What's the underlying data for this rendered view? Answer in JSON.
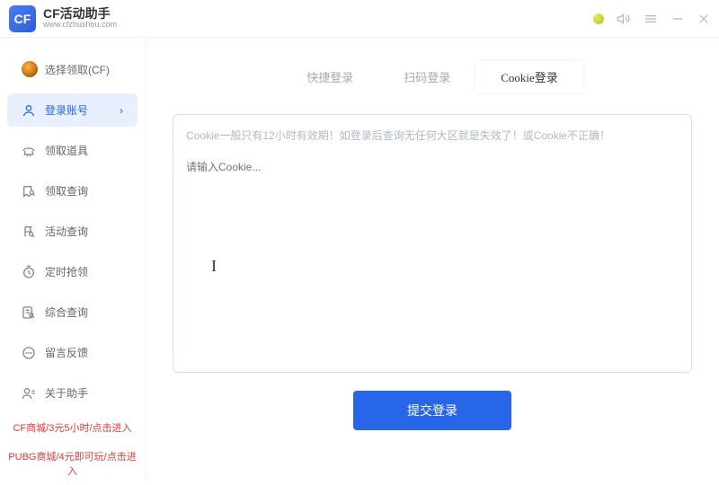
{
  "header": {
    "logo_text": "CF",
    "title": "CF活动助手",
    "url": "www.cfzhushou.com"
  },
  "sidebar": {
    "items": [
      {
        "label": "选择领取(CF)",
        "icon": "crown"
      },
      {
        "label": "登录账号",
        "icon": "user",
        "active": true
      },
      {
        "label": "领取道具",
        "icon": "tool"
      },
      {
        "label": "领取查询",
        "icon": "lookup"
      },
      {
        "label": "活动查询",
        "icon": "activity"
      },
      {
        "label": "定时抢领",
        "icon": "timer"
      },
      {
        "label": "综合查询",
        "icon": "search"
      },
      {
        "label": "留言反馈",
        "icon": "chat"
      },
      {
        "label": "关于助手",
        "icon": "about"
      }
    ],
    "promo1": "CF商城/3元5小时/点击进入",
    "promo2": "PUBG商城/4元即可玩/点击进入"
  },
  "tabs": {
    "quick": "快捷登录",
    "scan": "扫码登录",
    "cookie": "Cookie登录"
  },
  "cookie": {
    "hint": "Cookie一般只有12小时有效期！如登录后查询无任何大区就是失效了！或Cookie不正确！",
    "placeholder": "请输入Cookie..."
  },
  "submit_label": "提交登录"
}
